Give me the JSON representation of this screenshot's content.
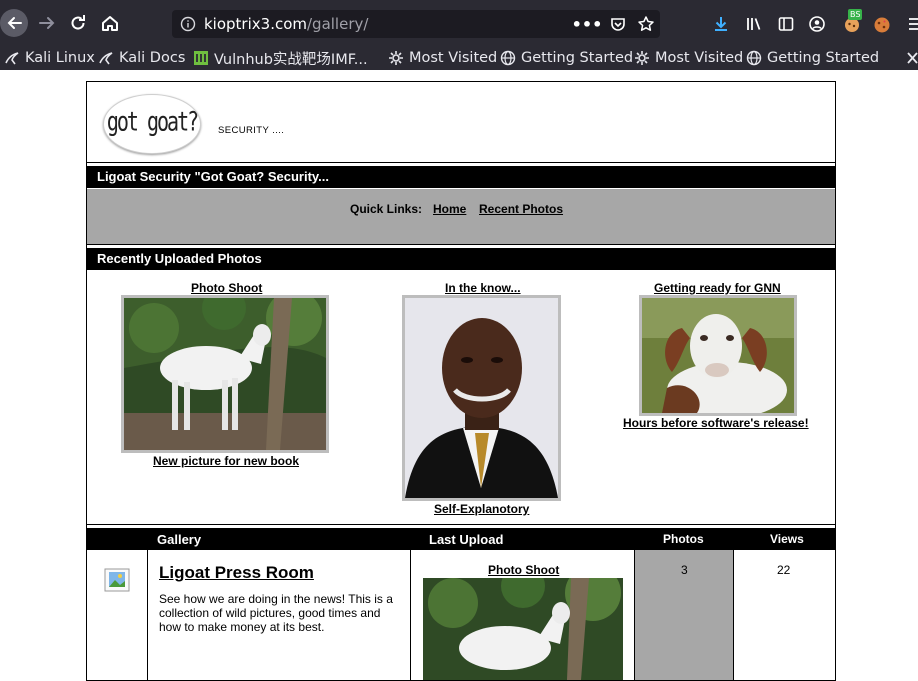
{
  "browser": {
    "url_domain": "kioptrix3.com",
    "url_path": "/gallery/",
    "bookmarks": [
      {
        "label": "Kali Linux",
        "icon": "kali-dragon-icon"
      },
      {
        "label": "Kali Docs",
        "icon": "kali-dragon-icon"
      },
      {
        "label": "Vulnhub实战靶场IMF...",
        "icon": "vulnhub-icon"
      },
      {
        "label": "Most Visited",
        "icon": "gear-icon"
      },
      {
        "label": "Getting Started",
        "icon": "globe-icon"
      },
      {
        "label": "Most Visited",
        "icon": "gear-icon"
      },
      {
        "label": "Getting Started",
        "icon": "globe-icon"
      }
    ],
    "extension_badge": "BS"
  },
  "page": {
    "logo_text": "got goat?",
    "tagline": "SECURITY ....",
    "site_bar": "Ligoat Security \"Got Goat? Security...",
    "quick_links_label": "Quick Links:",
    "quick_links": [
      "Home",
      "Recent Photos"
    ],
    "recent_header": "Recently Uploaded Photos",
    "recent_photos": [
      {
        "title": "Photo Shoot",
        "caption": "New picture for new book",
        "image": "white-goat-photo"
      },
      {
        "title": "In the know...",
        "caption": "Self-Explanotory",
        "image": "man-portrait-photo"
      },
      {
        "title": "Getting ready for GNN",
        "caption": "Hours before software's release!",
        "image": "goat-closeup-photo"
      }
    ],
    "gallery_table": {
      "headers": {
        "gallery": "Gallery",
        "last_upload": "Last Upload",
        "photos": "Photos",
        "views": "Views"
      },
      "rows": [
        {
          "name": "Ligoat Press Room",
          "description": "See how we are doing in the news! This is a collection of wild pictures, good times and how to make money at its best.",
          "last_upload_title": "Photo Shoot",
          "photos": "3",
          "views": "22"
        }
      ]
    }
  }
}
